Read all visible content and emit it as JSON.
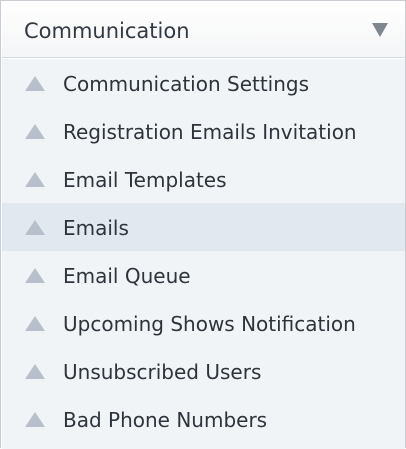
{
  "menu": {
    "title": "Communication",
    "toggle_icon": "caret-down-icon",
    "items": [
      {
        "label": "Communication Settings",
        "icon": "triangle-up-icon",
        "active": false
      },
      {
        "label": "Registration Emails Invitation",
        "icon": "triangle-up-icon",
        "active": false
      },
      {
        "label": "Email Templates",
        "icon": "triangle-up-icon",
        "active": false
      },
      {
        "label": "Emails",
        "icon": "triangle-up-icon",
        "active": true
      },
      {
        "label": "Email Queue",
        "icon": "triangle-up-icon",
        "active": false
      },
      {
        "label": "Upcoming Shows Notification",
        "icon": "triangle-up-icon",
        "active": false
      },
      {
        "label": "Unsubscribed Users",
        "icon": "triangle-up-icon",
        "active": false
      },
      {
        "label": "Bad Phone Numbers",
        "icon": "triangle-up-icon",
        "active": false
      }
    ]
  },
  "colors": {
    "header_text": "#333a41",
    "item_text": "#2d343b",
    "list_background": "#f1f4f7",
    "active_background": "#e2e8f0",
    "icon": "#b7c0ca",
    "caret": "#7f868d"
  }
}
